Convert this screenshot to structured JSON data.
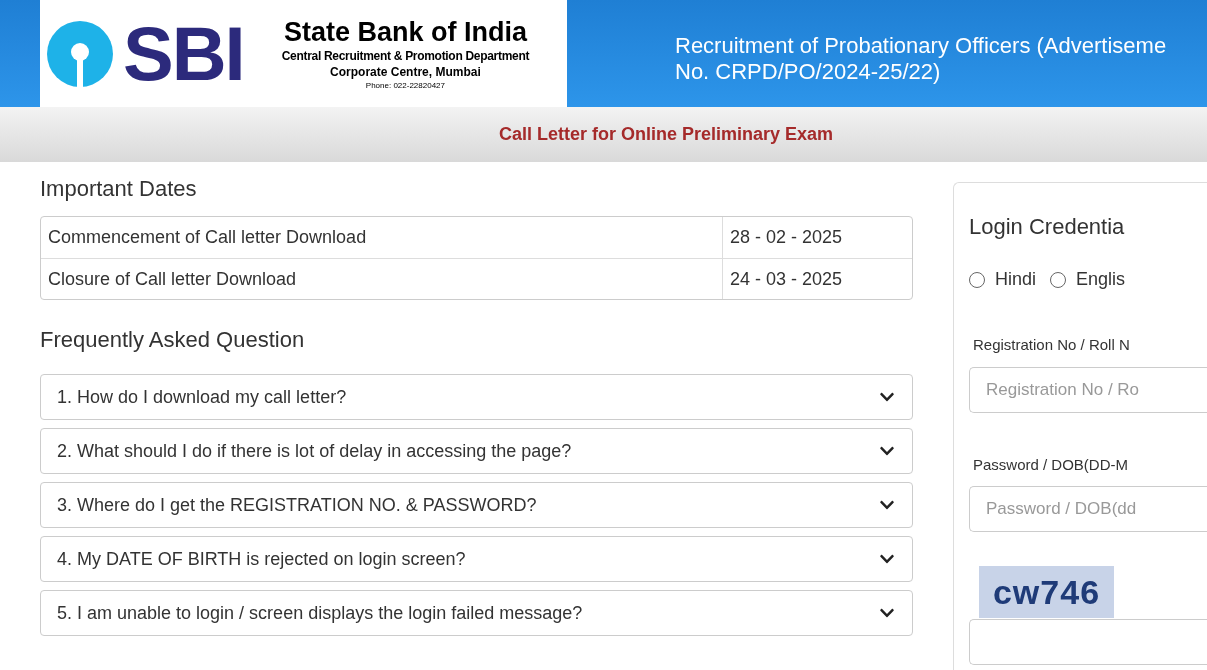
{
  "header": {
    "logo_text": "SBI",
    "bank_name": "State Bank of India",
    "department": "Central Recruitment & Promotion Department",
    "office": "Corporate Centre, Mumbai",
    "phone": "Phone: 022-22820427",
    "title_lines": [
      "Recruitment of Probationary Officers (Advertiseme",
      "No. CRPD/PO/2024-25/22)"
    ]
  },
  "subheader": "Call Letter for Online Preliminary Exam",
  "important_dates": {
    "heading": "Important Dates",
    "rows": [
      {
        "label": "Commencement of Call letter Download",
        "date": "28 - 02 - 2025"
      },
      {
        "label": "Closure of Call letter Download",
        "date": "24 - 03 - 2025"
      }
    ]
  },
  "faq": {
    "heading": "Frequently Asked Question",
    "items": [
      {
        "question": "1. How do I download my call letter?",
        "expanded": false
      },
      {
        "question": "2. What should I do if there is lot of delay in accessing the page?",
        "expanded": false
      },
      {
        "question": "3. Where do I get the REGISTRATION NO. & PASSWORD?",
        "expanded": false
      },
      {
        "question": "4. My DATE OF BIRTH is rejected on login screen?",
        "expanded": false
      },
      {
        "question": "5. I am unable to login / screen displays the login failed message?",
        "expanded": false
      }
    ]
  },
  "login": {
    "heading": "Login Credentia",
    "languages": [
      {
        "label": "Hindi",
        "selected": false
      },
      {
        "label": "Englis",
        "selected": false
      }
    ],
    "fields": [
      {
        "label": "Registration No / Roll N",
        "placeholder": "Registration No / Ro"
      },
      {
        "label": "Password / DOB(DD-M",
        "placeholder": "Password / DOB(dd"
      }
    ],
    "captcha": "cw746"
  }
}
